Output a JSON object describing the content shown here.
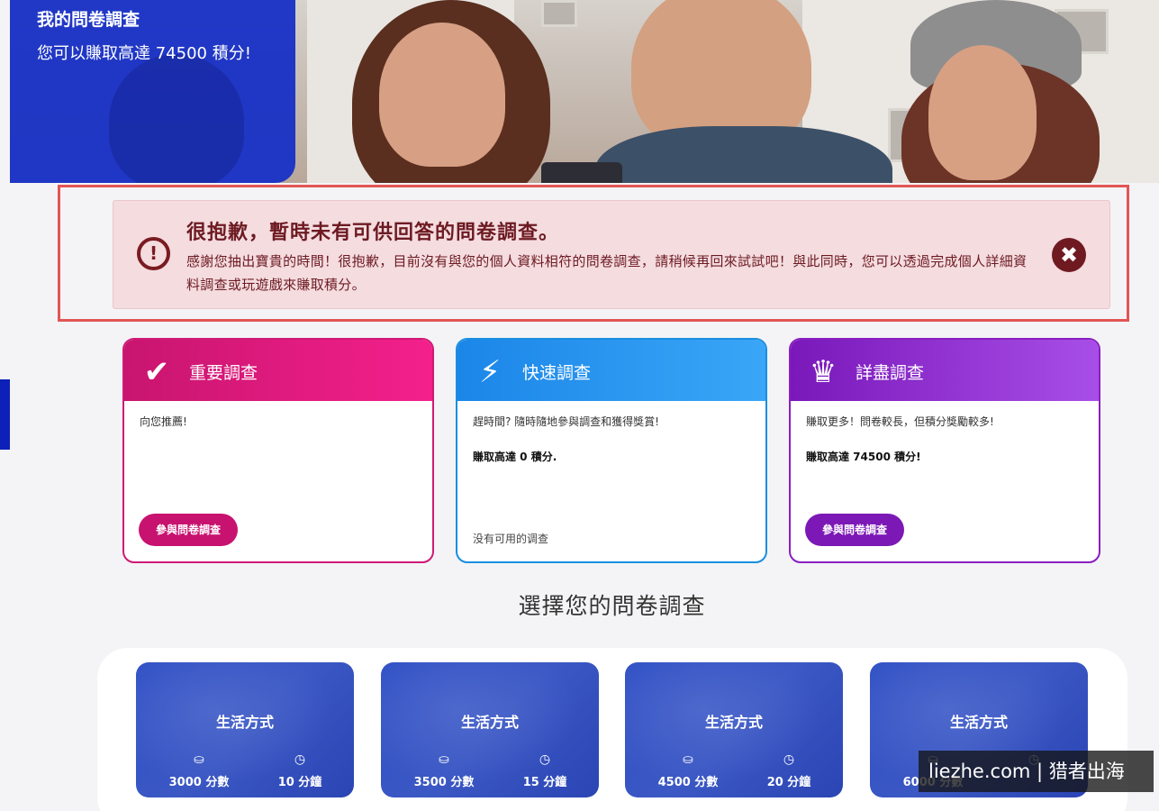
{
  "hero": {
    "title": "我的問卷調查",
    "subtitle": "您可以賺取高達 74500 積分!"
  },
  "alert": {
    "title": "很抱歉，暫時未有可供回答的問卷調查。",
    "message": "感謝您抽出寶貴的時間！很抱歉，目前沒有與您的個人資料相符的問卷調查，請稍候再回來試試吧！與此同時，您可以透過完成個人詳細資料調查或玩遊戲來賺取積分。",
    "icon": "!",
    "close_icon": "✖"
  },
  "categories": [
    {
      "label": "重要調查",
      "icon": "✔",
      "desc": "向您推薦!",
      "button": "參與問卷調查"
    },
    {
      "label": "快速調查",
      "icon": "⚡",
      "desc": "趕時間? 隨時隨地參與調查和獲得獎賞!",
      "points": "賺取高達 0 積分.",
      "none": "没有可用的调查"
    },
    {
      "label": "詳盡調查",
      "icon": "♛",
      "desc": "賺取更多！問卷較長，但積分獎勵較多!",
      "points": "賺取高達 74500 積分!",
      "button": "參與問卷調查"
    }
  ],
  "section_title": "選擇您的問卷調查",
  "survey_tiles": [
    {
      "title": "生活方式",
      "points": "3000 分數",
      "time": "10 分鐘"
    },
    {
      "title": "生活方式",
      "points": "3500 分數",
      "time": "15 分鐘"
    },
    {
      "title": "生活方式",
      "points": "4500 分數",
      "time": "20 分鐘"
    },
    {
      "title": "生活方式",
      "points": "6000 分數",
      "time": ""
    }
  ],
  "icons": {
    "coin": "⛀",
    "clock": "◷"
  },
  "watermark": "liezhe.com | 猎者出海",
  "colors": {
    "brand_blue": "#1a32c6",
    "alert_dark": "#6d1a22",
    "pink": "#c8126f",
    "sky": "#1b86e8",
    "purple": "#7c18b6"
  }
}
